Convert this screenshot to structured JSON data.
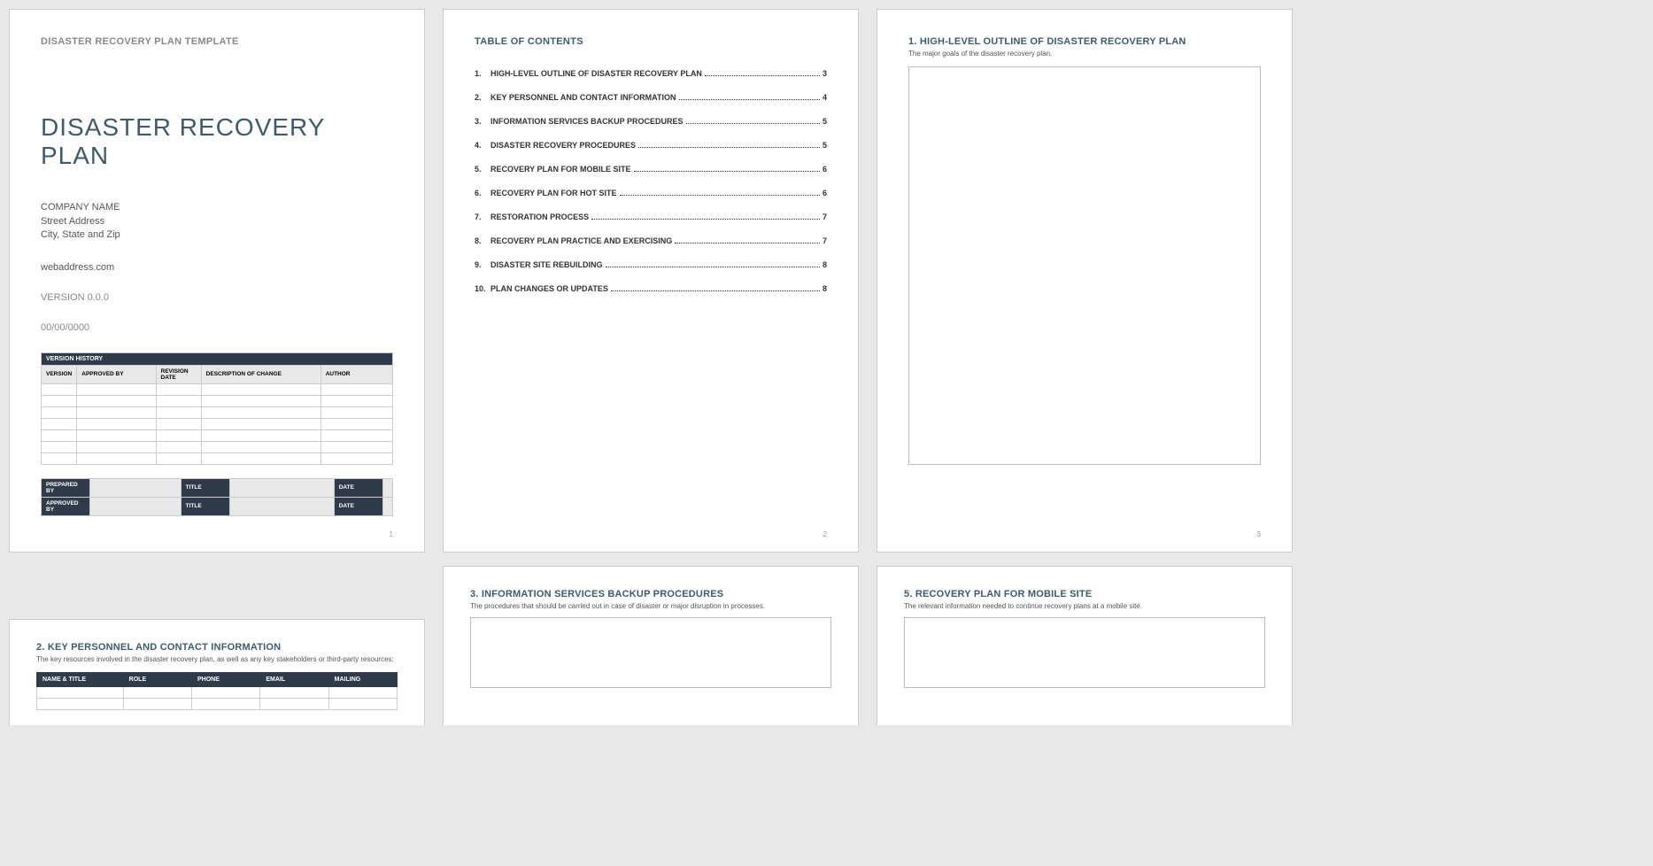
{
  "page1": {
    "templateLabel": "DISASTER RECOVERY PLAN TEMPLATE",
    "title": "DISASTER RECOVERY PLAN",
    "company": "COMPANY NAME",
    "street": "Street Address",
    "cityStateZip": "City, State and Zip",
    "web": "webaddress.com",
    "version": "VERSION 0.0.0",
    "date": "00/00/0000",
    "versionHistoryHeader": "VERSION HISTORY",
    "vhCols": {
      "version": "VERSION",
      "approvedBy": "APPROVED BY",
      "revisionDate": "REVISION DATE",
      "description": "DESCRIPTION OF CHANGE",
      "author": "AUTHOR"
    },
    "sign": {
      "preparedBy": "PREPARED BY",
      "approvedBy": "APPROVED BY",
      "title": "TITLE",
      "date": "DATE"
    },
    "pageNum": "1"
  },
  "page2": {
    "tocTitle": "TABLE OF CONTENTS",
    "items": [
      {
        "num": "1.",
        "text": "HIGH-LEVEL OUTLINE OF DISASTER RECOVERY PLAN",
        "page": "3"
      },
      {
        "num": "2.",
        "text": "KEY PERSONNEL AND CONTACT INFORMATION",
        "page": "4"
      },
      {
        "num": "3.",
        "text": "INFORMATION SERVICES BACKUP PROCEDURES",
        "page": "5"
      },
      {
        "num": "4.",
        "text": "DISASTER RECOVERY PROCEDURES",
        "page": "5"
      },
      {
        "num": "5.",
        "text": "RECOVERY PLAN FOR MOBILE SITE",
        "page": "6"
      },
      {
        "num": "6.",
        "text": "RECOVERY PLAN FOR HOT SITE",
        "page": "6"
      },
      {
        "num": "7.",
        "text": "RESTORATION PROCESS",
        "page": "7"
      },
      {
        "num": "8.",
        "text": "RECOVERY PLAN PRACTICE AND EXERCISING",
        "page": "7"
      },
      {
        "num": "9.",
        "text": "DISASTER SITE REBUILDING",
        "page": "8"
      },
      {
        "num": "10.",
        "text": "PLAN CHANGES OR UPDATES",
        "page": "8"
      }
    ],
    "pageNum": "2"
  },
  "page3": {
    "heading": "1.  HIGH-LEVEL OUTLINE OF DISASTER RECOVERY PLAN",
    "desc": "The major goals of the disaster recovery plan.",
    "pageNum": "3"
  },
  "page4": {
    "heading": "2.  KEY PERSONNEL AND CONTACT INFORMATION",
    "desc": "The key resources involved in the disaster recovery plan, as well as any key stakeholders or third-party resources:",
    "cols": {
      "nameTitle": "NAME & TITLE",
      "role": "ROLE",
      "phone": "PHONE",
      "email": "EMAIL",
      "mailing": "MAILING"
    }
  },
  "page5": {
    "heading": "3.  INFORMATION SERVICES BACKUP PROCEDURES",
    "desc": "The procedures that should be carried out in case of disaster or major disruption in processes."
  },
  "page6": {
    "heading": "5.  RECOVERY PLAN FOR MOBILE SITE",
    "desc": "The relevant information needed to continue recovery plans at a mobile site."
  }
}
